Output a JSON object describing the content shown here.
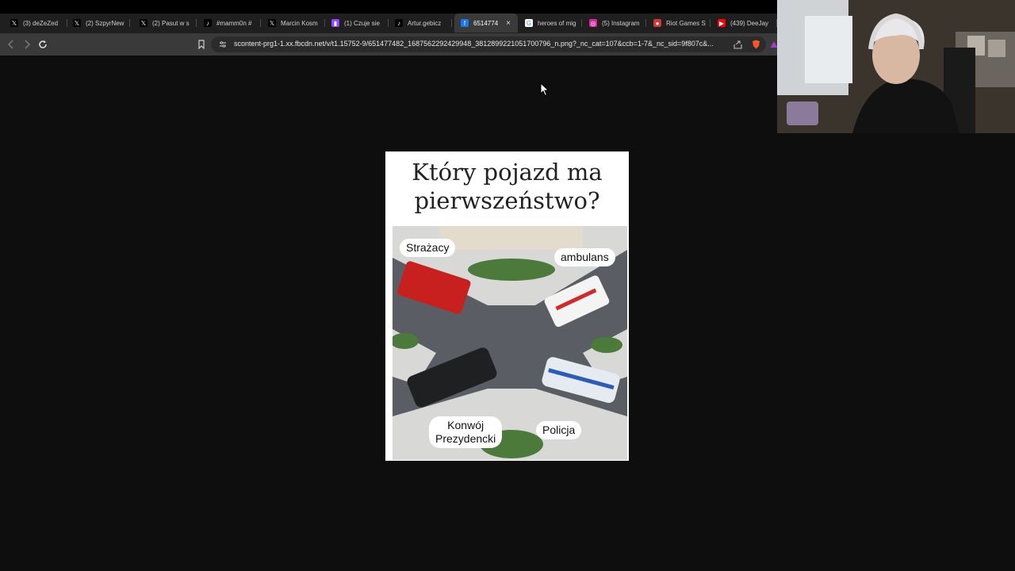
{
  "browser": {
    "tabs": [
      {
        "label": "(3) deZeZed",
        "favicon": "x-icon",
        "color": "#000000"
      },
      {
        "label": "(2) SzpyrNew",
        "favicon": "x-icon",
        "color": "#000000"
      },
      {
        "label": "(2) Pasut w s",
        "favicon": "x-icon",
        "color": "#000000"
      },
      {
        "label": "#mamm0n #",
        "favicon": "tiktok-icon",
        "color": "#000000"
      },
      {
        "label": "Marcin Kosm",
        "favicon": "x-icon",
        "color": "#000000"
      },
      {
        "label": "(1) Czuje sie",
        "favicon": "twitch-icon",
        "color": "#9146ff"
      },
      {
        "label": "Artur.gebicz",
        "favicon": "tiktok-icon",
        "color": "#000000"
      },
      {
        "label": "6514774",
        "favicon": "facebook-icon",
        "color": "#1877f2",
        "active": true
      },
      {
        "label": "heroes of mig",
        "favicon": "google-icon",
        "color": "#ffffff"
      },
      {
        "label": "(5) Instagram",
        "favicon": "instagram-icon",
        "color": "#d6249f"
      },
      {
        "label": "Riot Games S",
        "favicon": "riot-icon",
        "color": "#d13639"
      },
      {
        "label": "(439) DeeJay",
        "favicon": "youtube-icon",
        "color": "#ff0000"
      }
    ],
    "url": "scontent-prg1-1.xx.fbcdn.net/v/t1.15752-9/651477482_1687562292429948_3812899221051700796_n.png?_nc_cat=107&ccb=1-7&_nc_sid=9f807c&..."
  },
  "image": {
    "title_line1": "Który pojazd ma",
    "title_line2": "pierwszeństwo?",
    "labels": {
      "fire": "Strażacy",
      "ambulance": "ambulans",
      "convoy_line1": "Konwój",
      "convoy_line2": "Prezydencki",
      "police": "Policja"
    }
  }
}
